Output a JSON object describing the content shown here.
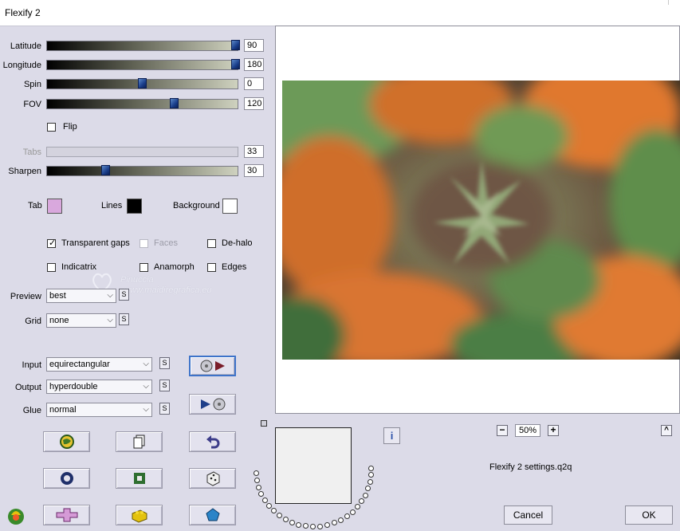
{
  "window": {
    "title": "Flexify 2"
  },
  "sliders": [
    {
      "label": "Latitude",
      "value": "90",
      "fill": 0.99,
      "disabled": false
    },
    {
      "label": "Longitude",
      "value": "180",
      "fill": 0.99,
      "disabled": false
    },
    {
      "label": "Spin",
      "value": "0",
      "fill": 0.5,
      "disabled": false
    },
    {
      "label": "FOV",
      "value": "120",
      "fill": 0.67,
      "disabled": false
    },
    {
      "label": "Tabs",
      "value": "33",
      "fill": null,
      "disabled": true
    },
    {
      "label": "Sharpen",
      "value": "30",
      "fill": 0.31,
      "disabled": false
    }
  ],
  "flip": {
    "label": "Flip",
    "checked": false
  },
  "colors": {
    "tab": {
      "label": "Tab",
      "hex": "#d9a8dd"
    },
    "lines": {
      "label": "Lines",
      "hex": "#000000"
    },
    "background": {
      "label": "Background",
      "hex": "#ffffff"
    }
  },
  "options": {
    "transparent_gaps": {
      "label": "Transparent gaps",
      "checked": true
    },
    "faces": {
      "label": "Faces",
      "checked": false,
      "disabled": true
    },
    "de_halo": {
      "label": "De-halo",
      "checked": false
    },
    "indicatrix": {
      "label": "Indicatrix",
      "checked": false
    },
    "anamorph": {
      "label": "Anamorph",
      "checked": false
    },
    "edges": {
      "label": "Edges",
      "checked": false
    }
  },
  "selects": {
    "preview": {
      "label": "Preview",
      "value": "best"
    },
    "grid": {
      "label": "Grid",
      "value": "none"
    },
    "input": {
      "label": "Input",
      "value": "equirectangular"
    },
    "output": {
      "label": "Output",
      "value": "hyperdouble"
    },
    "glue": {
      "label": "Glue",
      "value": "normal"
    }
  },
  "s_button_label": "S",
  "watermark": {
    "line1": "Pinuccia",
    "line2": "www.maidiregrafica.eu"
  },
  "zoom": {
    "minus": "−",
    "value": "50%",
    "plus": "+"
  },
  "settings_file": "Flexify 2 settings.q2q",
  "buttons": {
    "cancel": "Cancel",
    "ok": "OK",
    "info": "i",
    "collapse": "^"
  },
  "accent_colors": {
    "selected_border": "#3e73c9",
    "dialog_bg": "#dcdbe8"
  }
}
